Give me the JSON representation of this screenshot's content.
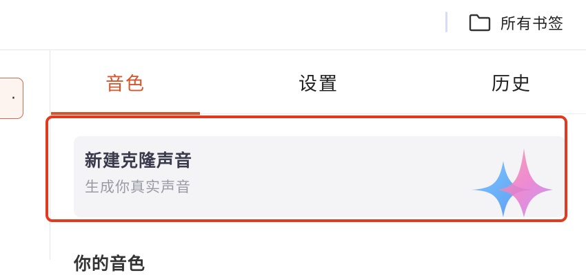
{
  "bookmark_bar": {
    "all_bookmarks_label": "所有书签",
    "folder_icon": "folder-icon"
  },
  "left_panel": {
    "chip_text": "·"
  },
  "tabs": [
    {
      "label": "音色",
      "active": true
    },
    {
      "label": "设置",
      "active": false
    },
    {
      "label": "历史",
      "active": false
    }
  ],
  "clone_card": {
    "title": "新建克隆声音",
    "subtitle": "生成你真实声音",
    "icon": "voice-wave-icon"
  },
  "my_voices_section": {
    "title": "你的音色"
  },
  "colors": {
    "accent": "#d7542b",
    "highlight_border": "#e23a1f",
    "card_bg": "#f4f4f6",
    "wave_blue": "#5aa8f5",
    "wave_pink": "#f07cc8"
  }
}
